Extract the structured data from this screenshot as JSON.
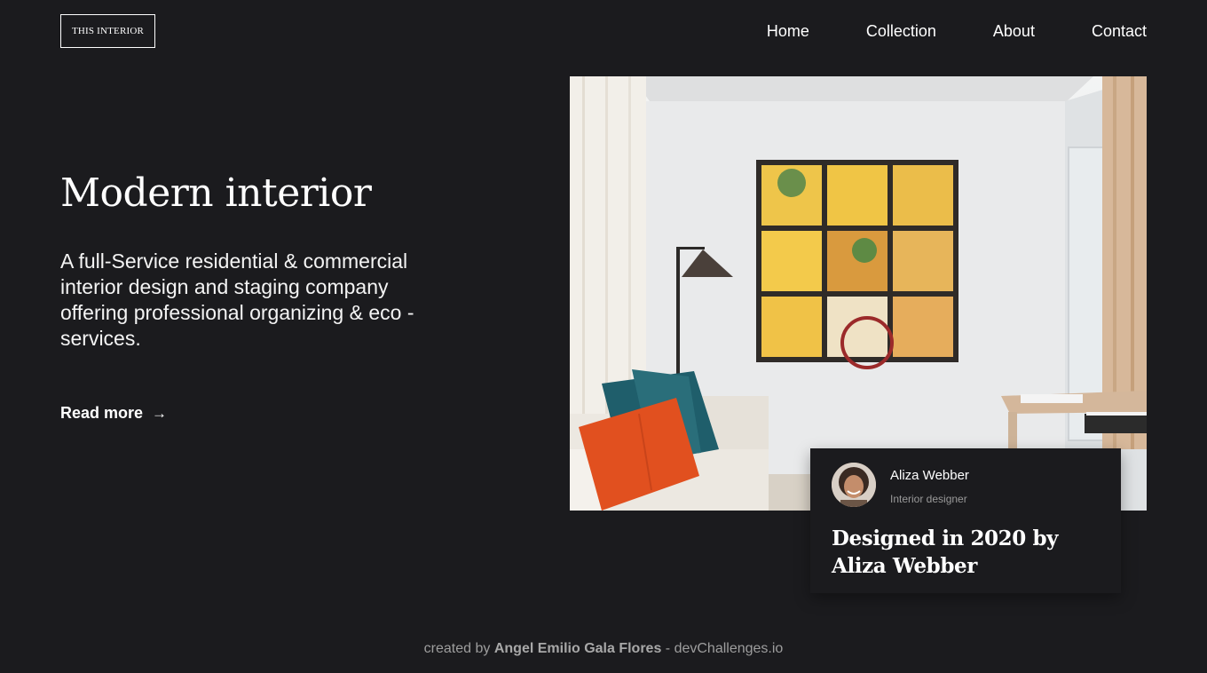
{
  "header": {
    "logo_text": "THIS INTERIOR",
    "nav": [
      {
        "label": "Home"
      },
      {
        "label": "Collection"
      },
      {
        "label": "About"
      },
      {
        "label": "Contact"
      }
    ]
  },
  "hero": {
    "title": "Modern interior",
    "description": "A full-Service residential & commercial interior design and staging company offering professional organizing & eco - services.",
    "cta_label": "Read more",
    "cta_icon": "arrow-right-icon"
  },
  "photo": {
    "subject": "living-room-with-yellow-wall-art"
  },
  "designer_card": {
    "name": "Aliza Webber",
    "role": "Interior designer",
    "title": "Designed in 2020 by Aliza Webber"
  },
  "footer": {
    "prefix": "created by",
    "author": "Angel Emilio Gala Flores",
    "suffix": "- devChallenges.io"
  },
  "colors": {
    "background": "#1b1b1e",
    "text": "#ffffff",
    "muted": "#9d9d9d"
  }
}
